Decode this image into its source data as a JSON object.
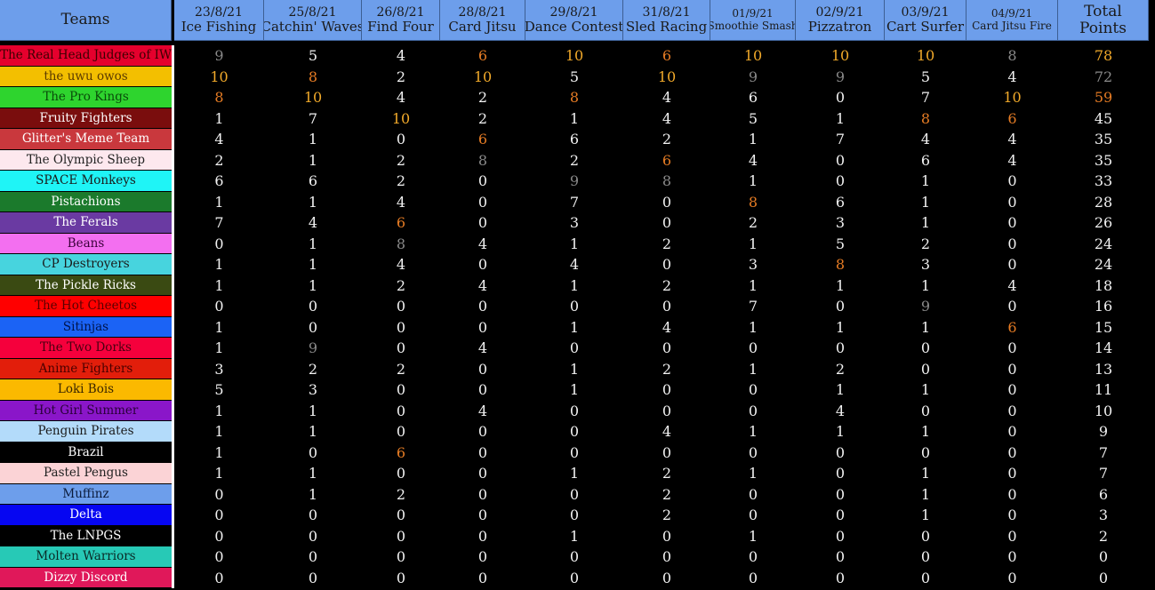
{
  "header": {
    "teams_label": "Teams",
    "columns": [
      {
        "date": "23/8/21",
        "game": "Ice Fishing"
      },
      {
        "date": "25/8/21",
        "game": "Catchin' Waves"
      },
      {
        "date": "26/8/21",
        "game": "Find Four"
      },
      {
        "date": "28/8/21",
        "game": "Card Jitsu"
      },
      {
        "date": "29/8/21",
        "game": "Dance Contest"
      },
      {
        "date": "31/8/21",
        "game": "Sled Racing"
      },
      {
        "date": "01/9/21",
        "game": "Smoothie Smash"
      },
      {
        "date": "02/9/21",
        "game": "Pizzatron"
      },
      {
        "date": "03/9/21",
        "game": "Cart Surfer"
      },
      {
        "date": "04/9/21",
        "game": "Card Jitsu Fire"
      }
    ],
    "total_label_1": "Total",
    "total_label_2": "Points"
  },
  "colors": {
    "first_place": "#f1a92a",
    "second_place": "#e67c24",
    "third_place": "#8a8a8a",
    "header_bg": "#6d9eeb"
  },
  "teams": [
    {
      "name": "The Real Head Judges of IW",
      "bg": "#e5002d",
      "fg": "#3b0000",
      "scores": [
        9,
        5,
        4,
        6,
        10,
        6,
        10,
        10,
        10,
        8
      ],
      "ranks": [
        "g3",
        "",
        "",
        "o",
        "gold",
        "o",
        "gold",
        "gold",
        "gold",
        "g3"
      ],
      "total": 78,
      "total_rank": "gold"
    },
    {
      "name": "the uwu owos",
      "bg": "#f3bf00",
      "fg": "#5a3a00",
      "scores": [
        10,
        8,
        2,
        10,
        5,
        10,
        9,
        9,
        5,
        4
      ],
      "ranks": [
        "gold",
        "o",
        "",
        "gold",
        "",
        "gold",
        "g3",
        "g3",
        "",
        ""
      ],
      "total": 72,
      "total_rank": "g3"
    },
    {
      "name": "The Pro Kings",
      "bg": "#2ed42e",
      "fg": "#0a4a0a",
      "scores": [
        8,
        10,
        4,
        2,
        8,
        4,
        6,
        0,
        7,
        10
      ],
      "ranks": [
        "o",
        "gold",
        "",
        "",
        "o",
        "",
        "",
        "",
        "",
        "gold"
      ],
      "total": 59,
      "total_rank": "o"
    },
    {
      "name": "Fruity Fighters",
      "bg": "#7a0d0d",
      "fg": "#ffffff",
      "scores": [
        1,
        7,
        10,
        2,
        1,
        4,
        5,
        1,
        8,
        6
      ],
      "ranks": [
        "",
        "",
        "gold",
        "",
        "",
        "",
        "",
        "",
        "o",
        "o"
      ],
      "total": 45,
      "total_rank": ""
    },
    {
      "name": "Glitter's Meme Team",
      "bg": "#c9383d",
      "fg": "#ffffff",
      "scores": [
        4,
        1,
        0,
        6,
        6,
        2,
        1,
        7,
        4,
        4
      ],
      "ranks": [
        "",
        "",
        "",
        "o",
        "",
        "",
        "",
        "",
        "",
        ""
      ],
      "total": 35,
      "total_rank": ""
    },
    {
      "name": "The Olympic Sheep",
      "bg": "#fde8ee",
      "fg": "#222222",
      "scores": [
        2,
        1,
        2,
        8,
        2,
        6,
        4,
        0,
        6,
        4
      ],
      "ranks": [
        "",
        "",
        "",
        "g3",
        "",
        "o",
        "",
        "",
        "",
        ""
      ],
      "total": 35,
      "total_rank": ""
    },
    {
      "name": "SPACE Monkeys",
      "bg": "#1ff4f6",
      "fg": "#1a1a1a",
      "scores": [
        6,
        6,
        2,
        0,
        9,
        8,
        1,
        0,
        1,
        0
      ],
      "ranks": [
        "",
        "",
        "",
        "",
        "g3",
        "g3",
        "",
        "",
        "",
        ""
      ],
      "total": 33,
      "total_rank": ""
    },
    {
      "name": "Pistachions",
      "bg": "#1b7a2c",
      "fg": "#ffffff",
      "scores": [
        1,
        1,
        4,
        0,
        7,
        0,
        8,
        6,
        1,
        0
      ],
      "ranks": [
        "",
        "",
        "",
        "",
        "",
        "",
        "o",
        "",
        "",
        ""
      ],
      "total": 28,
      "total_rank": ""
    },
    {
      "name": "The Ferals",
      "bg": "#6a3aa2",
      "fg": "#ffffff",
      "scores": [
        7,
        4,
        6,
        0,
        3,
        0,
        2,
        3,
        1,
        0
      ],
      "ranks": [
        "",
        "",
        "o",
        "",
        "",
        "",
        "",
        "",
        "",
        ""
      ],
      "total": 26,
      "total_rank": ""
    },
    {
      "name": "Beans",
      "bg": "#f36ff0",
      "fg": "#3a003a",
      "scores": [
        0,
        1,
        8,
        4,
        1,
        2,
        1,
        5,
        2,
        0
      ],
      "ranks": [
        "",
        "",
        "g3",
        "",
        "",
        "",
        "",
        "",
        "",
        ""
      ],
      "total": 24,
      "total_rank": ""
    },
    {
      "name": "CP Destroyers",
      "bg": "#47d4de",
      "fg": "#1a1a1a",
      "scores": [
        1,
        1,
        4,
        0,
        4,
        0,
        3,
        8,
        3,
        0
      ],
      "ranks": [
        "",
        "",
        "",
        "",
        "",
        "",
        "",
        "o",
        "",
        ""
      ],
      "total": 24,
      "total_rank": ""
    },
    {
      "name": "The Pickle Ricks",
      "bg": "#3a4a12",
      "fg": "#ffffff",
      "scores": [
        1,
        1,
        2,
        4,
        1,
        2,
        1,
        1,
        1,
        4
      ],
      "ranks": [
        "",
        "",
        "",
        "",
        "",
        "",
        "",
        "",
        "",
        ""
      ],
      "total": 18,
      "total_rank": ""
    },
    {
      "name": "The Hot Cheetos",
      "bg": "#ff0000",
      "fg": "#5a0000",
      "scores": [
        0,
        0,
        0,
        0,
        0,
        0,
        7,
        0,
        9,
        0
      ],
      "ranks": [
        "",
        "",
        "",
        "",
        "",
        "",
        "",
        "",
        "g3",
        ""
      ],
      "total": 16,
      "total_rank": ""
    },
    {
      "name": "Sitinjas",
      "bg": "#1b63f5",
      "fg": "#00144a",
      "scores": [
        1,
        0,
        0,
        0,
        1,
        4,
        1,
        1,
        1,
        6
      ],
      "ranks": [
        "",
        "",
        "",
        "",
        "",
        "",
        "",
        "",
        "",
        "o"
      ],
      "total": 15,
      "total_rank": ""
    },
    {
      "name": "The Two Dorks",
      "bg": "#f5003c",
      "fg": "#4a0010",
      "scores": [
        1,
        9,
        0,
        4,
        0,
        0,
        0,
        0,
        0,
        0
      ],
      "ranks": [
        "",
        "g3",
        "",
        "",
        "",
        "",
        "",
        "",
        "",
        ""
      ],
      "total": 14,
      "total_rank": ""
    },
    {
      "name": "Anime Fighters",
      "bg": "#e21e0b",
      "fg": "#4a0000",
      "scores": [
        3,
        2,
        2,
        0,
        1,
        2,
        1,
        2,
        0,
        0
      ],
      "ranks": [
        "",
        "",
        "",
        "",
        "",
        "",
        "",
        "",
        "",
        ""
      ],
      "total": 13,
      "total_rank": ""
    },
    {
      "name": "Loki Bois",
      "bg": "#fbb900",
      "fg": "#3a2600",
      "scores": [
        5,
        3,
        0,
        0,
        1,
        0,
        0,
        1,
        1,
        0
      ],
      "ranks": [
        "",
        "",
        "",
        "",
        "",
        "",
        "",
        "",
        "",
        ""
      ],
      "total": 11,
      "total_rank": ""
    },
    {
      "name": "Hot Girl Summer",
      "bg": "#8a16c9",
      "fg": "#2a003a",
      "scores": [
        1,
        1,
        0,
        4,
        0,
        0,
        0,
        4,
        0,
        0
      ],
      "ranks": [
        "",
        "",
        "",
        "",
        "",
        "",
        "",
        "",
        "",
        ""
      ],
      "total": 10,
      "total_rank": ""
    },
    {
      "name": "Penguin Pirates",
      "bg": "#b3dbfa",
      "fg": "#1a1a1a",
      "scores": [
        1,
        1,
        0,
        0,
        0,
        4,
        1,
        1,
        1,
        0
      ],
      "ranks": [
        "",
        "",
        "",
        "",
        "",
        "",
        "",
        "",
        "",
        ""
      ],
      "total": 9,
      "total_rank": ""
    },
    {
      "name": "Brazil",
      "bg": "#000000",
      "fg": "#ffffff",
      "scores": [
        1,
        0,
        6,
        0,
        0,
        0,
        0,
        0,
        0,
        0
      ],
      "ranks": [
        "",
        "",
        "o",
        "",
        "",
        "",
        "",
        "",
        "",
        ""
      ],
      "total": 7,
      "total_rank": ""
    },
    {
      "name": "Pastel Pengus",
      "bg": "#fbd3d6",
      "fg": "#222222",
      "scores": [
        1,
        1,
        0,
        0,
        1,
        2,
        1,
        0,
        1,
        0
      ],
      "ranks": [
        "",
        "",
        "",
        "",
        "",
        "",
        "",
        "",
        "",
        ""
      ],
      "total": 7,
      "total_rank": ""
    },
    {
      "name": "Muffinz",
      "bg": "#6d9eeb",
      "fg": "#0a1a3a",
      "scores": [
        0,
        1,
        2,
        0,
        0,
        2,
        0,
        0,
        1,
        0
      ],
      "ranks": [
        "",
        "",
        "",
        "",
        "",
        "",
        "",
        "",
        "",
        ""
      ],
      "total": 6,
      "total_rank": ""
    },
    {
      "name": "Delta",
      "bg": "#0606f2",
      "fg": "#ffffff",
      "scores": [
        0,
        0,
        0,
        0,
        0,
        2,
        0,
        0,
        1,
        0
      ],
      "ranks": [
        "",
        "",
        "",
        "",
        "",
        "",
        "",
        "",
        "",
        ""
      ],
      "total": 3,
      "total_rank": ""
    },
    {
      "name": "The LNPGS",
      "bg": "#000000",
      "fg": "#ffffff",
      "scores": [
        0,
        0,
        0,
        0,
        1,
        0,
        1,
        0,
        0,
        0
      ],
      "ranks": [
        "",
        "",
        "",
        "",
        "",
        "",
        "",
        "",
        "",
        ""
      ],
      "total": 2,
      "total_rank": ""
    },
    {
      "name": "Molten Warriors",
      "bg": "#27c9b6",
      "fg": "#0a2a26",
      "scores": [
        0,
        0,
        0,
        0,
        0,
        0,
        0,
        0,
        0,
        0
      ],
      "ranks": [
        "",
        "",
        "",
        "",
        "",
        "",
        "",
        "",
        "",
        ""
      ],
      "total": 0,
      "total_rank": ""
    },
    {
      "name": "Dizzy Discord",
      "bg": "#e0185a",
      "fg": "#ffffff",
      "scores": [
        0,
        0,
        0,
        0,
        0,
        0,
        0,
        0,
        0,
        0
      ],
      "ranks": [
        "",
        "",
        "",
        "",
        "",
        "",
        "",
        "",
        "",
        ""
      ],
      "total": 0,
      "total_rank": ""
    }
  ]
}
